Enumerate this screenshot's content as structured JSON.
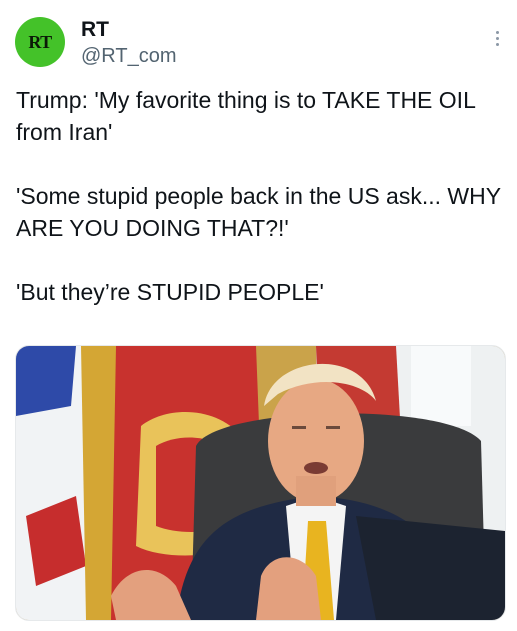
{
  "account": {
    "display_name": "RT",
    "handle": "@RT_com",
    "avatar_text": "RT",
    "avatar_color": "#44c229"
  },
  "tweet": {
    "line1": "Trump: 'My favorite thing is to TAKE THE OIL from Iran'",
    "line2": "'Some stupid people back in the US ask... WHY ARE YOU DOING THAT?!'",
    "line3": "'But they’re STUPID PEOPLE'"
  },
  "icons": {
    "more": "more-options-icon"
  },
  "colors": {
    "text": "#0f1419",
    "secondary": "#536471",
    "brand": "#44c229"
  }
}
